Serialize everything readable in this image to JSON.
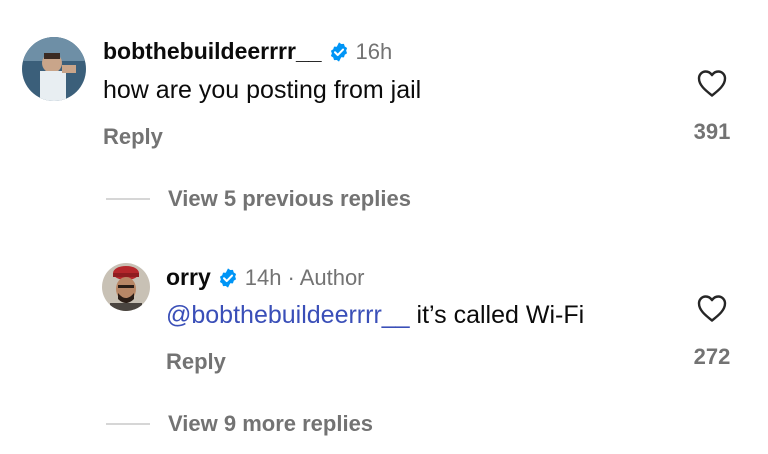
{
  "comments": [
    {
      "username": "bobthebuildeerrrr__",
      "time": "16h",
      "author_label": "",
      "text": "how are you posting from jail",
      "mention": "",
      "reply_label": "Reply",
      "likes": "391"
    },
    {
      "username": "orry",
      "time": "14h",
      "author_label": "· Author",
      "mention": "@bobthebuildeerrrr__",
      "text": " it’s called Wi-Fi",
      "reply_label": "Reply",
      "likes": "272"
    }
  ],
  "view_previous": "View 5 previous replies",
  "view_more": "View 9 more replies",
  "colors": {
    "verified": "#0095f6",
    "secondary_text": "#737373",
    "mention": "#3a4fb8"
  },
  "icons": [
    "verified-badge-icon",
    "heart-icon"
  ]
}
